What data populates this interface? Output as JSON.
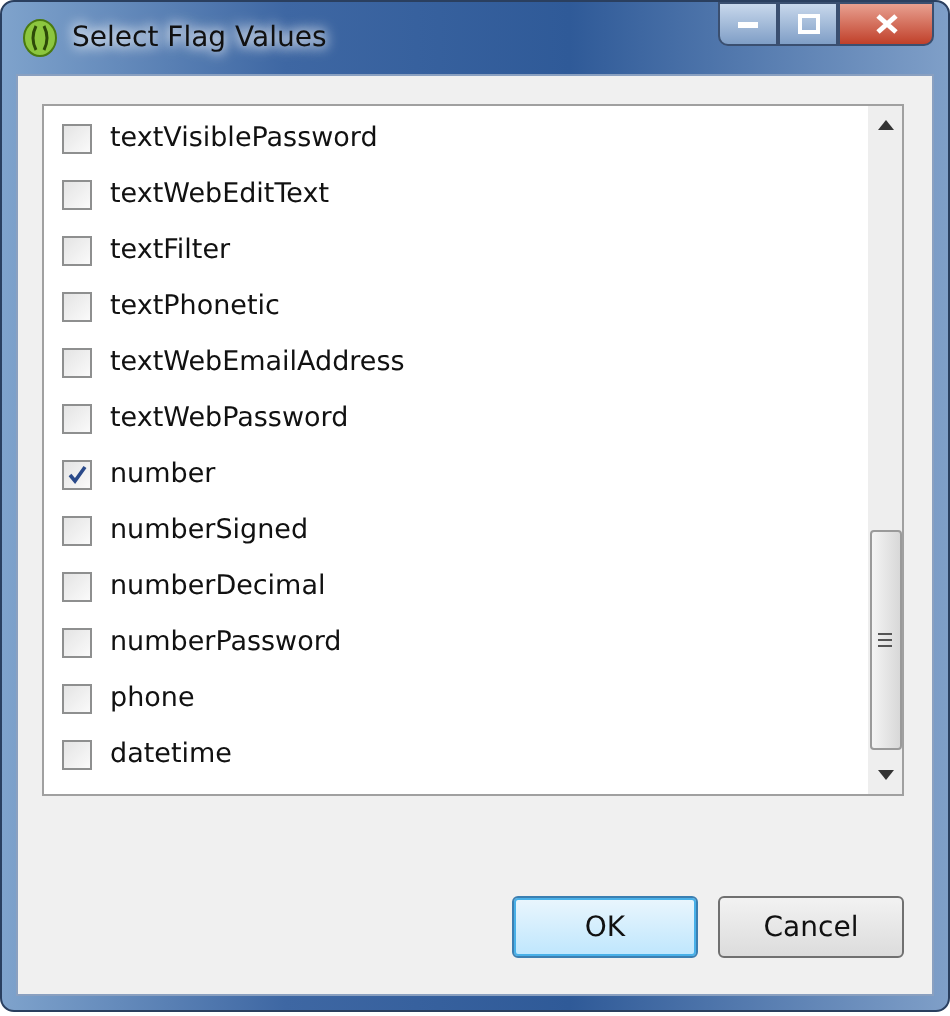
{
  "window": {
    "title": "Select Flag Values"
  },
  "flags": [
    {
      "label": "textVisiblePassword",
      "checked": false
    },
    {
      "label": "textWebEditText",
      "checked": false
    },
    {
      "label": "textFilter",
      "checked": false
    },
    {
      "label": "textPhonetic",
      "checked": false
    },
    {
      "label": "textWebEmailAddress",
      "checked": false
    },
    {
      "label": "textWebPassword",
      "checked": false
    },
    {
      "label": "number",
      "checked": true
    },
    {
      "label": "numberSigned",
      "checked": false
    },
    {
      "label": "numberDecimal",
      "checked": false
    },
    {
      "label": "numberPassword",
      "checked": false
    },
    {
      "label": "phone",
      "checked": false
    },
    {
      "label": "datetime",
      "checked": false
    }
  ],
  "buttons": [
    {
      "label": "OK",
      "kind": "default"
    },
    {
      "label": "Cancel",
      "kind": "normal"
    }
  ]
}
